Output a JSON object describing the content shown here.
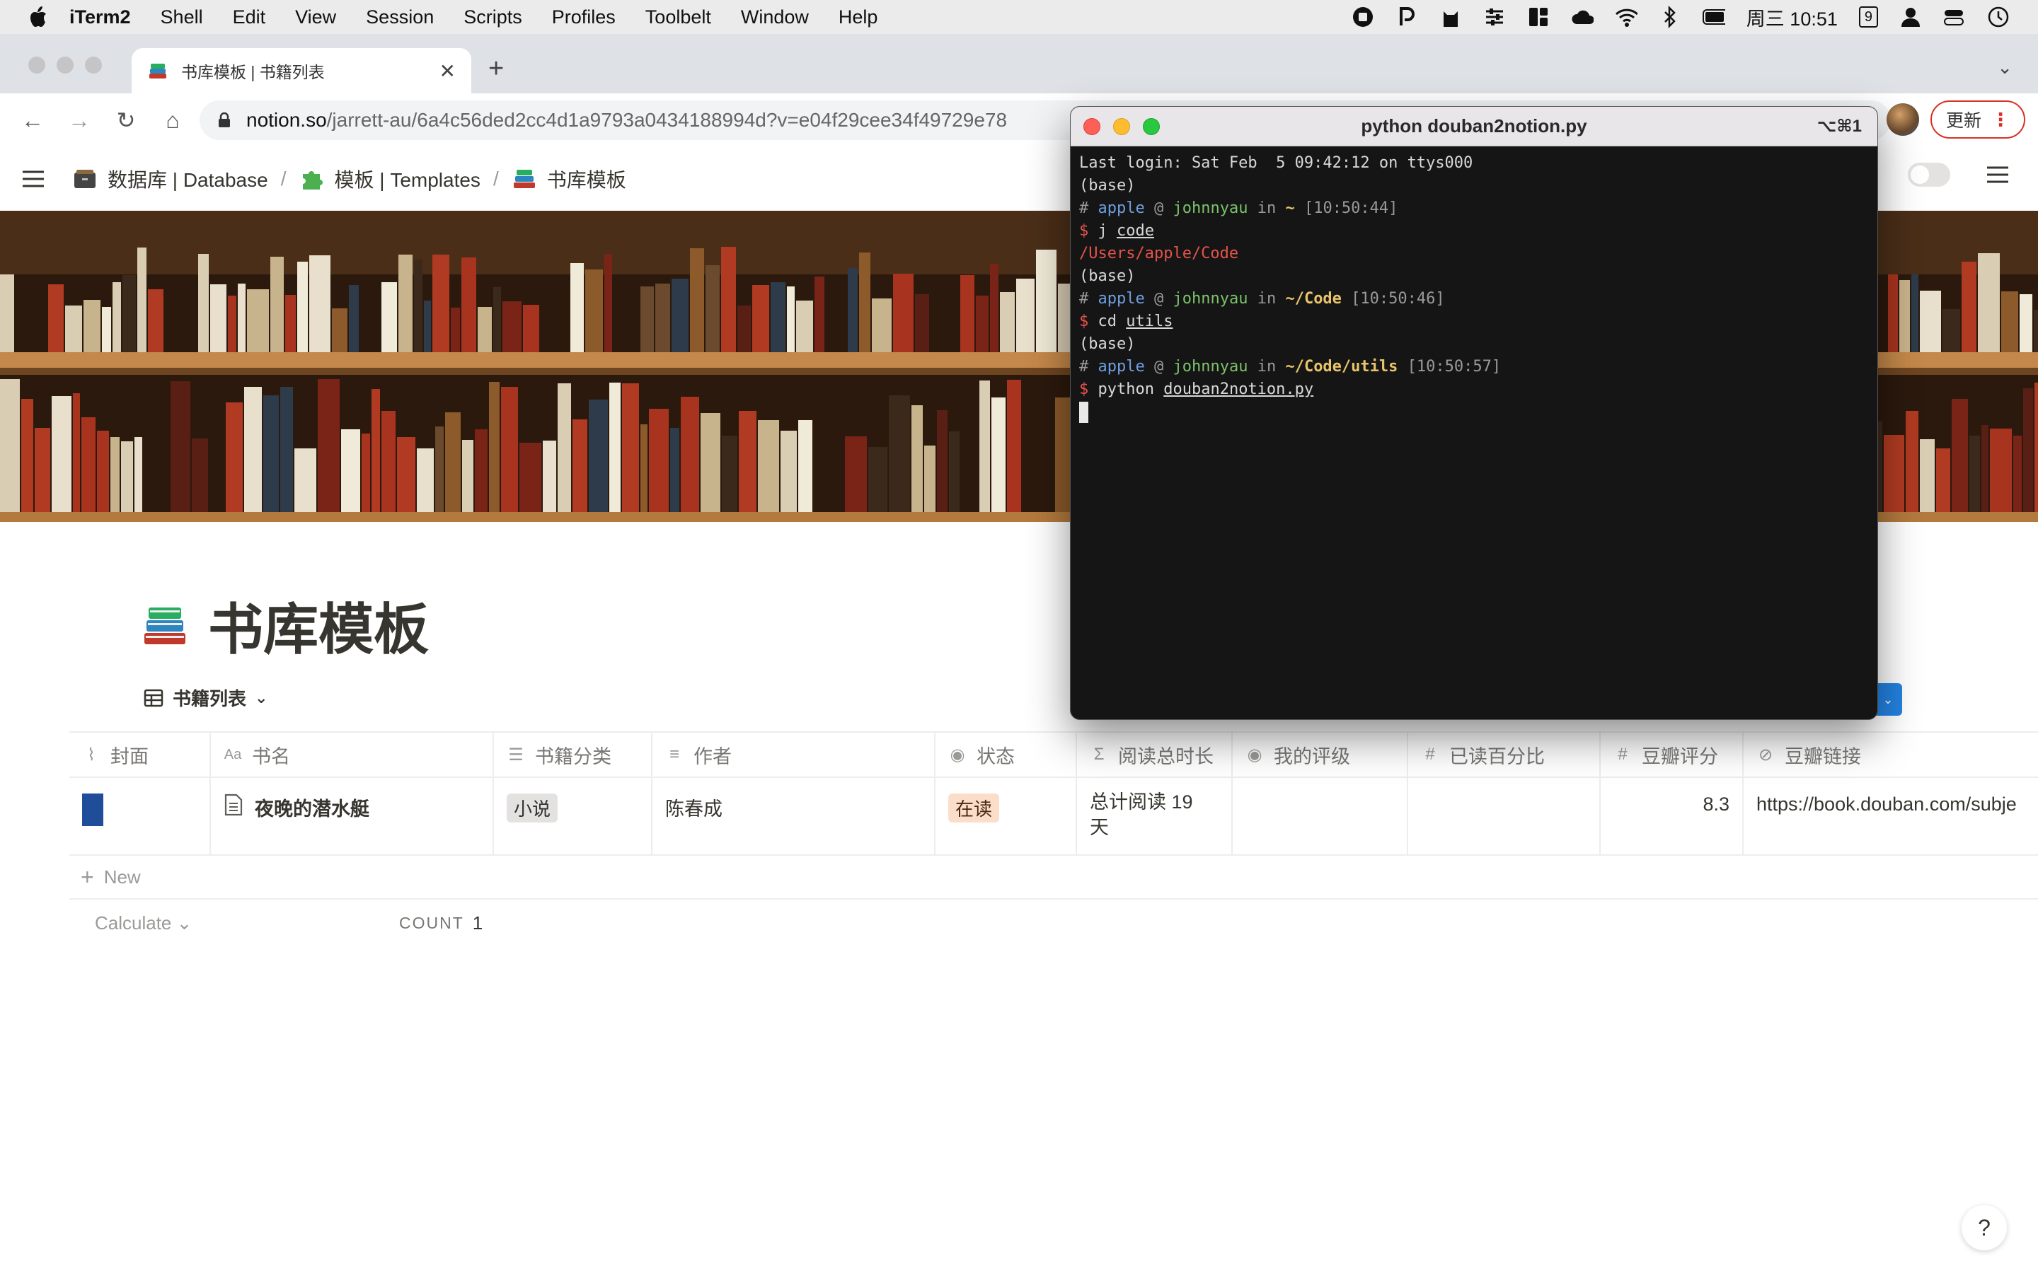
{
  "menubar": {
    "app": "iTerm2",
    "items": [
      "Shell",
      "Edit",
      "View",
      "Session",
      "Scripts",
      "Profiles",
      "Toolbelt",
      "Window",
      "Help"
    ],
    "clock": "周三 10:51",
    "badge": "9"
  },
  "browser": {
    "tab_title": "书库模板 | 书籍列表",
    "url_host": "notion.so",
    "url_path": "/jarrett-au/6a4c56ded2cc4d1a9793a0434188994d?v=e04f29cee34f49729e78",
    "update_label": "更新"
  },
  "notion": {
    "breadcrumb": [
      {
        "label": "数据库 | Database"
      },
      {
        "label": "模板 | Templates"
      },
      {
        "label": "书库模板"
      }
    ],
    "page_title": "书库模板",
    "view_name": "书籍列表",
    "columns": [
      "封面",
      "书名",
      "书籍分类",
      "作者",
      "状态",
      "阅读总时长",
      "我的评级",
      "已读百分比",
      "豆瓣评分",
      "豆瓣链接"
    ],
    "rows": [
      {
        "name": "夜晚的潜水艇",
        "category": "小说",
        "author": "陈春成",
        "status": "在读",
        "duration_line1": "总计阅读 19",
        "duration_line2": "天",
        "rating": "",
        "percent": "",
        "douban_score": "8.3",
        "douban_link": "https://book.douban.com/subje"
      }
    ],
    "new_label": "New",
    "calculate_label": "Calculate",
    "count_label": "COUNT",
    "count_value": "1",
    "help_label": "?"
  },
  "terminal": {
    "title": "python douban2notion.py",
    "shortcut": "⌥⌘1",
    "last_login": "Last login: Sat Feb  5 09:42:12 on ttys000",
    "base": "(base)",
    "user": "apple",
    "host": "johnnyau",
    "prompt_1": {
      "dir": "~",
      "time": "[10:50:44]",
      "cmd": "j",
      "arg": "code"
    },
    "output_1": "/Users/apple/Code",
    "prompt_2": {
      "dir": "~/Code",
      "time": "[10:50:46]",
      "cmd": "cd",
      "arg": "utils"
    },
    "prompt_3": {
      "dir": "~/Code/utils",
      "time": "[10:50:57]",
      "cmd": "python",
      "arg": "douban2notion.py"
    }
  },
  "colors": {
    "tag_gray_bg": "#e3e2e0",
    "tag_orange_bg": "#fadec9",
    "accent_blue": "#2383e2",
    "update_red": "#d93025"
  }
}
